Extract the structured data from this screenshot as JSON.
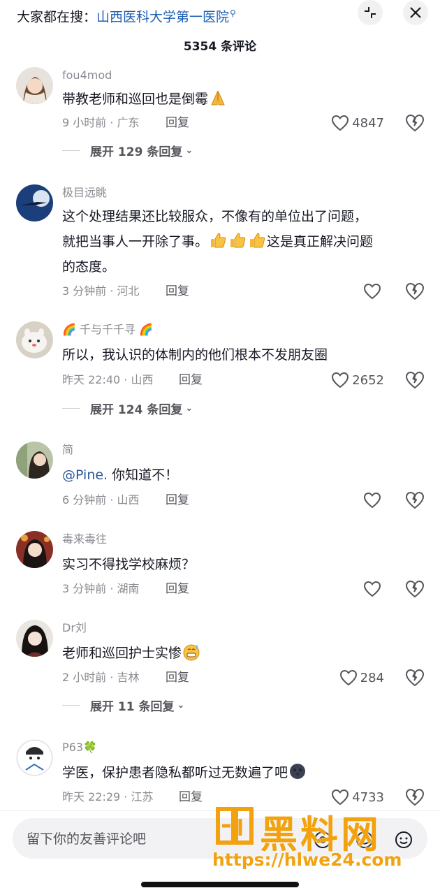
{
  "header": {
    "search_prefix": "大家都在搜：",
    "search_term": "山西医科大学第一医院",
    "comment_count": "5354 条评论"
  },
  "comments": [
    {
      "user": "fou4mod",
      "lines": [
        "带教老师和巡回也是倒霉"
      ],
      "time_location": "9 小时前 · 广东",
      "reply": "回复",
      "likes": "4847",
      "expand": "展开 129 条回复"
    },
    {
      "user": "极目远眺",
      "lines": [
        "这个处理结果还比较服众，不像有的单位出了问题，",
        "就把当事人一开除了事。",
        "的态度。"
      ],
      "line2_tail": "这是真正解决问题",
      "time_location": "3 分钟前 · 河北",
      "reply": "回复",
      "likes": ""
    },
    {
      "user": "千与千千寻",
      "lines": [
        "所以，我认识的体制内的他们根本不发朋友圈"
      ],
      "time_location": "昨天 22:40 · 山西",
      "reply": "回复",
      "likes": "2652",
      "expand": "展开 124 条回复"
    },
    {
      "user": "简",
      "mention": "@Pine.",
      "lines": [
        " 你知道不！"
      ],
      "time_location": "6 分钟前 · 山西",
      "reply": "回复",
      "likes": ""
    },
    {
      "user": "毒来毒往",
      "lines": [
        "实习不得找学校麻烦？"
      ],
      "time_location": "3 分钟前 · 湖南",
      "reply": "回复",
      "likes": ""
    },
    {
      "user": "Dr刘",
      "lines": [
        "老师和巡回护士实惨"
      ],
      "time_location": "2 小时前 · 吉林",
      "reply": "回复",
      "likes": "284",
      "expand": "展开 11 条回复"
    },
    {
      "user": "P63",
      "lines": [
        "学医，保护患者隐私都听过无数遍了吧"
      ],
      "time_location": "昨天 22:29 · 江苏",
      "reply": "回复",
      "likes": "4733"
    }
  ],
  "input": {
    "placeholder": "留下你的友善评论吧"
  },
  "watermark": {
    "text": "黑料网",
    "url": "https://hlwe24.com"
  },
  "icons": {
    "collapse": "collapse-icon",
    "close": "close-icon",
    "like": "heart-icon",
    "dislike": "broken-heart-icon"
  },
  "colors": {
    "mention": "#2b5797",
    "search_term": "#1f5fb3",
    "watermark": "#f2a20f"
  }
}
